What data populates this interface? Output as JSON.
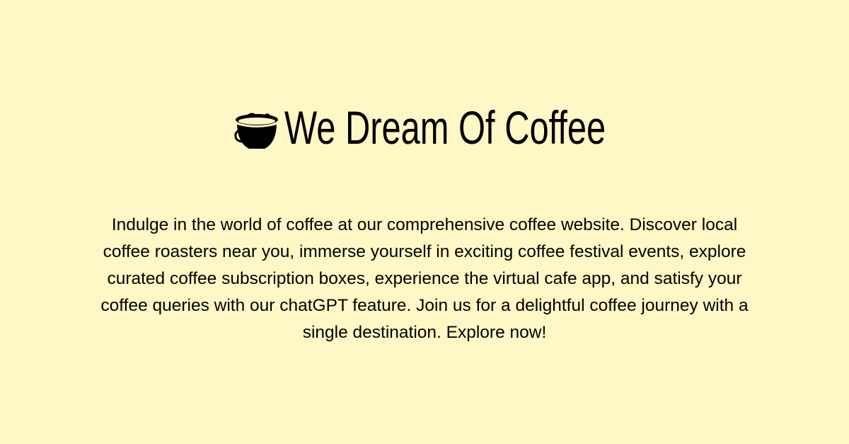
{
  "header": {
    "title": "We Dream Of Coffee",
    "logo_icon": "coffee-cup-icon"
  },
  "description": {
    "lines": [
      "Indulge in the world of coffee at our comprehensive coffee website. Discover local",
      "coffee roasters near you, immerse yourself in exciting coffee festival events, explore",
      "curated coffee subscription boxes, experience the virtual cafe app, and satisfy your",
      "coffee queries with our chatGPT feature. Join us for a delightful coffee journey with a",
      "single destination. Explore now!"
    ]
  },
  "colors": {
    "background": "#fef7c6",
    "text": "#000000"
  }
}
